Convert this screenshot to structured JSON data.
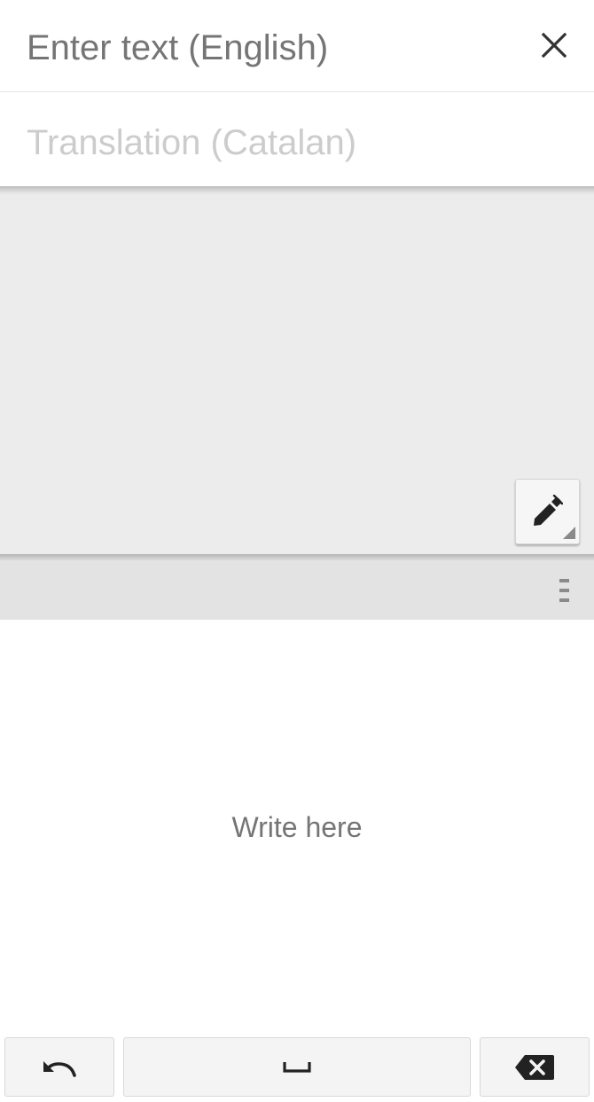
{
  "input": {
    "placeholder": "Enter text (English)"
  },
  "translation": {
    "placeholder": "Translation (Catalan)"
  },
  "handwriting": {
    "hint": "Write here"
  },
  "icons": {
    "close": "close-icon",
    "pen": "pen-icon",
    "menu": "menu-icon",
    "undo": "undo-icon",
    "space": "space-icon",
    "backspace": "backspace-icon"
  },
  "colors": {
    "placeholder_text": "#757575",
    "translation_text": "#cccccc",
    "results_background": "#ececec",
    "toolbar_background": "#e3e3e3"
  }
}
